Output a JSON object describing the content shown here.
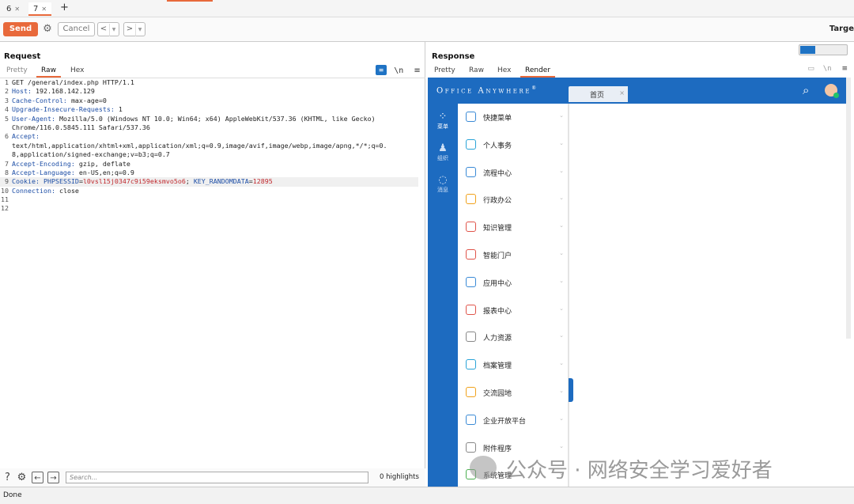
{
  "tabs": [
    {
      "label": "6",
      "active": false
    },
    {
      "label": "7",
      "active": true
    }
  ],
  "new_tab_label": "+",
  "toolbar": {
    "send_label": "Send",
    "cancel_label": "Cancel",
    "back_label": "<",
    "forward_label": ">",
    "target_label": "Targe"
  },
  "request": {
    "title": "Request",
    "subtabs": [
      "Pretty",
      "Raw",
      "Hex"
    ],
    "active_subtab": "Raw",
    "wrap_label": "\\n",
    "menu_label": "≡",
    "lines": [
      {
        "n": "1",
        "parts": [
          {
            "t": "GET /general/index.php HTTP/1.1",
            "c": "hv"
          }
        ]
      },
      {
        "n": "2",
        "parts": [
          {
            "t": "Host: ",
            "c": "hk"
          },
          {
            "t": "192.168.142.129",
            "c": "hv"
          }
        ]
      },
      {
        "n": "3",
        "parts": [
          {
            "t": "Cache-Control: ",
            "c": "hk"
          },
          {
            "t": "max-age=0",
            "c": "hv"
          }
        ]
      },
      {
        "n": "4",
        "parts": [
          {
            "t": "Upgrade-Insecure-Requests: ",
            "c": "hk"
          },
          {
            "t": "1",
            "c": "hv"
          }
        ]
      },
      {
        "n": "5",
        "parts": [
          {
            "t": "User-Agent: ",
            "c": "hk"
          },
          {
            "t": "Mozilla/5.0 (Windows NT 10.0; Win64; x64) AppleWebKit/537.36 (KHTML, like Gecko)",
            "c": "hv"
          }
        ]
      },
      {
        "n": "",
        "parts": [
          {
            "t": "Chrome/116.0.5845.111 Safari/537.36",
            "c": "hv"
          }
        ]
      },
      {
        "n": "6",
        "parts": [
          {
            "t": "Accept:",
            "c": "hk"
          }
        ]
      },
      {
        "n": "",
        "parts": [
          {
            "t": "text/html,application/xhtml+xml,application/xml;q=0.9,image/avif,image/webp,image/apng,*/*;q=0.",
            "c": "hv"
          }
        ]
      },
      {
        "n": "",
        "parts": [
          {
            "t": "8,application/signed-exchange;v=b3;q=0.7",
            "c": "hv"
          }
        ]
      },
      {
        "n": "7",
        "parts": [
          {
            "t": "Accept-Encoding: ",
            "c": "hk"
          },
          {
            "t": "gzip, deflate",
            "c": "hv"
          }
        ]
      },
      {
        "n": "8",
        "parts": [
          {
            "t": "Accept-Language: ",
            "c": "hk"
          },
          {
            "t": "en-US,en;q=0.9",
            "c": "hv"
          }
        ]
      },
      {
        "n": "9",
        "hl": true,
        "parts": [
          {
            "t": "Cookie: ",
            "c": "hk"
          },
          {
            "t": "PHPSESSID",
            "c": "ck"
          },
          {
            "t": "=",
            "c": "hv"
          },
          {
            "t": "l0vsl15j0347c9i59eksmvo5o6",
            "c": "cv"
          },
          {
            "t": "; ",
            "c": "hv"
          },
          {
            "t": "KEY_RANDOMDATA",
            "c": "ck"
          },
          {
            "t": "=",
            "c": "hv"
          },
          {
            "t": "12895",
            "c": "cv"
          }
        ]
      },
      {
        "n": "10",
        "parts": [
          {
            "t": "Connection: ",
            "c": "hk"
          },
          {
            "t": "close",
            "c": "hv"
          }
        ]
      },
      {
        "n": "11",
        "parts": []
      },
      {
        "n": "12",
        "parts": []
      }
    ],
    "search_placeholder": "Search...",
    "highlights_label": "0 highlights"
  },
  "response": {
    "title": "Response",
    "subtabs": [
      "Pretty",
      "Raw",
      "Hex",
      "Render"
    ],
    "active_subtab": "Render",
    "wrap_label": "\\n",
    "menu_label": "≡",
    "render": {
      "logo": "Office Anywhere",
      "logo_mark": "®",
      "home_tab": "首页",
      "home_tab_close": "×",
      "rail": [
        {
          "label": "菜单",
          "icon": "grid-icon"
        },
        {
          "label": "组织",
          "icon": "people-icon"
        },
        {
          "label": "消息",
          "icon": "chat-icon"
        }
      ],
      "menu_items": [
        {
          "label": "快捷菜单",
          "icon": "shortcut-icon",
          "color": "#3a8ad6"
        },
        {
          "label": "个人事务",
          "icon": "person-icon",
          "color": "#2aa4d8"
        },
        {
          "label": "流程中心",
          "icon": "flow-icon",
          "color": "#3a8ad6"
        },
        {
          "label": "行政办公",
          "icon": "briefcase-icon",
          "color": "#f0a21c"
        },
        {
          "label": "知识管理",
          "icon": "knowledge-icon",
          "color": "#e0544a"
        },
        {
          "label": "智能门户",
          "icon": "portal-icon",
          "color": "#e0544a"
        },
        {
          "label": "应用中心",
          "icon": "app-icon",
          "color": "#3a8ad6"
        },
        {
          "label": "报表中心",
          "icon": "report-icon",
          "color": "#e0544a"
        },
        {
          "label": "人力资源",
          "icon": "hr-icon",
          "color": "#888888"
        },
        {
          "label": "档案管理",
          "icon": "archive-icon",
          "color": "#2aa4d8"
        },
        {
          "label": "交流园地",
          "icon": "cup-icon",
          "color": "#f0a21c"
        },
        {
          "label": "企业开放平台",
          "icon": "cube-icon",
          "color": "#3a8ad6"
        },
        {
          "label": "附件程序",
          "icon": "paperclip-icon",
          "color": "#888888"
        },
        {
          "label": "系统管理",
          "icon": "system-icon",
          "color": "#4caf50"
        }
      ]
    }
  },
  "watermark": "公众号 · 网络安全学习爱好者",
  "status_text": "Done",
  "colors": {
    "accent": "#e8693b",
    "oa_blue": "#1d6bc0"
  }
}
